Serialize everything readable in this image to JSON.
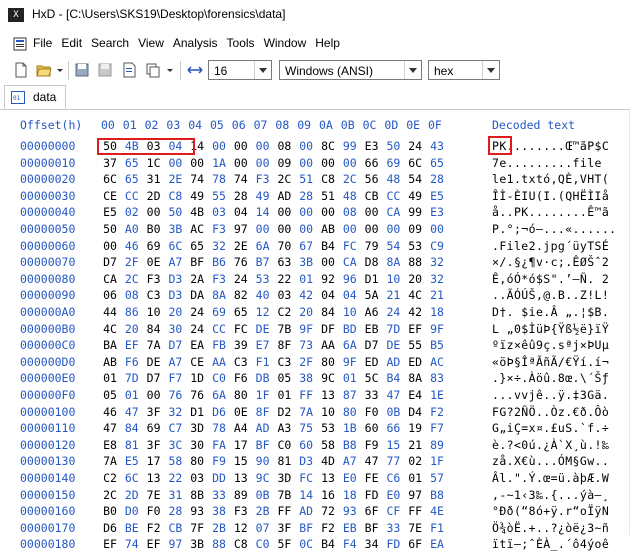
{
  "window": {
    "app": "HxD",
    "title": "HxD - [C:\\Users\\SKS19\\Desktop\\forensics\\data]",
    "icon": "hxd-app-icon"
  },
  "menu": [
    "File",
    "Edit",
    "Search",
    "View",
    "Analysis",
    "Tools",
    "Window",
    "Help"
  ],
  "toolbar": {
    "icons": [
      "new-file-icon",
      "open-folder-icon",
      "save-icon",
      "save-disabled-icon",
      "properties-icon",
      "copy-icon",
      "column-width-icon"
    ],
    "bytes_per_row": "16",
    "charset": "Windows (ANSI)",
    "offset_base": "hex"
  },
  "tab": {
    "label": "data"
  },
  "header": {
    "offset_label": "Offset(h)",
    "columns": [
      "00",
      "01",
      "02",
      "03",
      "04",
      "05",
      "06",
      "07",
      "08",
      "09",
      "0A",
      "0B",
      "0C",
      "0D",
      "0E",
      "0F"
    ],
    "decoded_label": "Decoded text"
  },
  "rows": [
    {
      "offset": "00000000",
      "bytes": [
        "50",
        "4B",
        "03",
        "04",
        "14",
        "00",
        "00",
        "00",
        "08",
        "00",
        "8C",
        "99",
        "E3",
        "50",
        "24",
        "43"
      ],
      "text": "PK........Œ™ãP$C"
    },
    {
      "offset": "00000010",
      "bytes": [
        "37",
        "65",
        "1C",
        "00",
        "00",
        "1A",
        "00",
        "00",
        "09",
        "00",
        "00",
        "00",
        "66",
        "69",
        "6C",
        "65"
      ],
      "text": "7e.........file"
    },
    {
      "offset": "00000020",
      "bytes": [
        "6C",
        "65",
        "31",
        "2E",
        "74",
        "78",
        "74",
        "F3",
        "2C",
        "51",
        "C8",
        "2C",
        "56",
        "48",
        "54",
        "28"
      ],
      "text": "le1.txtó,QÈ,VHT("
    },
    {
      "offset": "00000030",
      "bytes": [
        "CE",
        "CC",
        "2D",
        "C8",
        "49",
        "55",
        "28",
        "49",
        "AD",
        "28",
        "51",
        "48",
        "CB",
        "CC",
        "49",
        "E5"
      ],
      "text": "ÎÌ-ÈIU(I.(QHËÌIå"
    },
    {
      "offset": "00000040",
      "bytes": [
        "E5",
        "02",
        "00",
        "50",
        "4B",
        "03",
        "04",
        "14",
        "00",
        "00",
        "00",
        "08",
        "00",
        "CA",
        "99",
        "E3"
      ],
      "text": "å..PK........Ê™ã"
    },
    {
      "offset": "00000050",
      "bytes": [
        "50",
        "A0",
        "B0",
        "3B",
        "AC",
        "F3",
        "97",
        "00",
        "00",
        "00",
        "AB",
        "00",
        "00",
        "00",
        "09",
        "00"
      ],
      "text": "P.°;¬ó—...«......"
    },
    {
      "offset": "00000060",
      "bytes": [
        "00",
        "46",
        "69",
        "6C",
        "65",
        "32",
        "2E",
        "6A",
        "70",
        "67",
        "B4",
        "FC",
        "79",
        "54",
        "53",
        "C9"
      ],
      "text": ".File2.jpg´üyTSÉ"
    },
    {
      "offset": "00000070",
      "bytes": [
        "D7",
        "2F",
        "0E",
        "A7",
        "BF",
        "B6",
        "76",
        "B7",
        "63",
        "3B",
        "00",
        "CA",
        "D8",
        "8A",
        "88",
        "32"
      ],
      "text": "×/.§¿¶v·c;.ÊØŠˆ2"
    },
    {
      "offset": "00000080",
      "bytes": [
        "CA",
        "2C",
        "F3",
        "D3",
        "2A",
        "F3",
        "24",
        "53",
        "22",
        "01",
        "92",
        "96",
        "D1",
        "10",
        "20",
        "32"
      ],
      "text": "Ê,óÓ*ó$S\".’–Ñ. 2"
    },
    {
      "offset": "00000090",
      "bytes": [
        "06",
        "08",
        "C3",
        "D3",
        "DA",
        "8A",
        "82",
        "40",
        "03",
        "42",
        "04",
        "04",
        "5A",
        "21",
        "4C",
        "21"
      ],
      "text": "..ÃÓÚŠ‚@.B..Z!L!"
    },
    {
      "offset": "000000A0",
      "bytes": [
        "44",
        "86",
        "10",
        "20",
        "24",
        "69",
        "65",
        "12",
        "C2",
        "20",
        "84",
        "10",
        "A6",
        "24",
        "42",
        "18"
      ],
      "text": "D†. $ie.Â „.¦$B."
    },
    {
      "offset": "000000B0",
      "bytes": [
        "4C",
        "20",
        "84",
        "30",
        "24",
        "CC",
        "FC",
        "DE",
        "7B",
        "9F",
        "DF",
        "BD",
        "EB",
        "7D",
        "EF",
        "9F"
      ],
      "text": "L „0$ÌüÞ{Ÿß½ë}ïŸ"
    },
    {
      "offset": "000000C0",
      "bytes": [
        "BA",
        "EF",
        "7A",
        "D7",
        "EA",
        "FB",
        "39",
        "E7",
        "8F",
        "73",
        "AA",
        "6A",
        "D7",
        "DE",
        "55",
        "B5"
      ],
      "text": "ºïz×êû9ç.sªj×ÞUµ"
    },
    {
      "offset": "000000D0",
      "bytes": [
        "AB",
        "F6",
        "DE",
        "A7",
        "CE",
        "AA",
        "C3",
        "F1",
        "C3",
        "2F",
        "80",
        "9F",
        "ED",
        "AD",
        "ED",
        "AC"
      ],
      "text": "«öÞ§ÎªÃñÃ/€Ÿí.í¬"
    },
    {
      "offset": "000000E0",
      "bytes": [
        "01",
        "7D",
        "D7",
        "F7",
        "1D",
        "C0",
        "F6",
        "DB",
        "05",
        "38",
        "9C",
        "01",
        "5C",
        "B4",
        "8A",
        "83"
      ],
      "text": ".}×÷.Àöû.8œ.\\´Šƒ"
    },
    {
      "offset": "000000F0",
      "bytes": [
        "05",
        "01",
        "00",
        "76",
        "76",
        "6A",
        "80",
        "1F",
        "01",
        "FF",
        "13",
        "87",
        "33",
        "47",
        "E4",
        "1E"
      ],
      "text": "...vvjê..ÿ.‡3Gä."
    },
    {
      "offset": "00000100",
      "bytes": [
        "46",
        "47",
        "3F",
        "32",
        "D1",
        "D6",
        "0E",
        "8F",
        "D2",
        "7A",
        "10",
        "80",
        "F0",
        "0B",
        "D4",
        "F2"
      ],
      "text": "FG?2ÑÖ..Òz.€ð.Ôò"
    },
    {
      "offset": "00000110",
      "bytes": [
        "47",
        "84",
        "69",
        "C7",
        "3D",
        "78",
        "A4",
        "AD",
        "A3",
        "75",
        "53",
        "1B",
        "60",
        "66",
        "19",
        "F7"
      ],
      "text": "G„iÇ=x¤.£uS.`f.÷"
    },
    {
      "offset": "00000120",
      "bytes": [
        "E8",
        "81",
        "3F",
        "3C",
        "30",
        "FA",
        "17",
        "BF",
        "C0",
        "60",
        "58",
        "B8",
        "F9",
        "15",
        "21",
        "89"
      ],
      "text": "è.?<0ú.¿À`X¸ù.!‰"
    },
    {
      "offset": "00000130",
      "bytes": [
        "7A",
        "E5",
        "17",
        "58",
        "80",
        "F9",
        "15",
        "90",
        "81",
        "D3",
        "4D",
        "A7",
        "47",
        "77",
        "02",
        "1F"
      ],
      "text": "zå.X€ù...ÓM§Gw.."
    },
    {
      "offset": "00000140",
      "bytes": [
        "C2",
        "6C",
        "13",
        "22",
        "03",
        "DD",
        "13",
        "9C",
        "3D",
        "FC",
        "13",
        "E0",
        "FE",
        "C6",
        "01",
        "57"
      ],
      "text": "Âl.\".Ý.œ=ü.àþÆ.W"
    },
    {
      "offset": "00000150",
      "bytes": [
        "2C",
        "2D",
        "7E",
        "31",
        "8B",
        "33",
        "89",
        "0B",
        "7B",
        "14",
        "16",
        "18",
        "FD",
        "E0",
        "97",
        "B8"
      ],
      "text": ",-~1‹3‰.{...ýà—¸"
    },
    {
      "offset": "00000160",
      "bytes": [
        "B0",
        "D0",
        "F0",
        "28",
        "93",
        "38",
        "F3",
        "2B",
        "FF",
        "AD",
        "72",
        "93",
        "6F",
        "CF",
        "FF",
        "4E"
      ],
      "text": "°Ðð(“8ó+ÿ.r“oÏÿN"
    },
    {
      "offset": "00000170",
      "bytes": [
        "D6",
        "BE",
        "F2",
        "CB",
        "7F",
        "2B",
        "12",
        "07",
        "3F",
        "BF",
        "F2",
        "EB",
        "BF",
        "33",
        "7E",
        "F1"
      ],
      "text": "Ö¾òË.+..?¿òë¿3~ñ"
    },
    {
      "offset": "00000180",
      "bytes": [
        "EF",
        "74",
        "EF",
        "97",
        "3B",
        "88",
        "C8",
        "C0",
        "5F",
        "0C",
        "B4",
        "F4",
        "34",
        "FD",
        "6F",
        "EA"
      ],
      "text": "ïtï—;ˆÈÀ_.´ô4ýoê"
    }
  ],
  "highlights": {
    "note": "PK signature bytes 50 4B 03 04 and decoded 'PK' boxed in red"
  }
}
